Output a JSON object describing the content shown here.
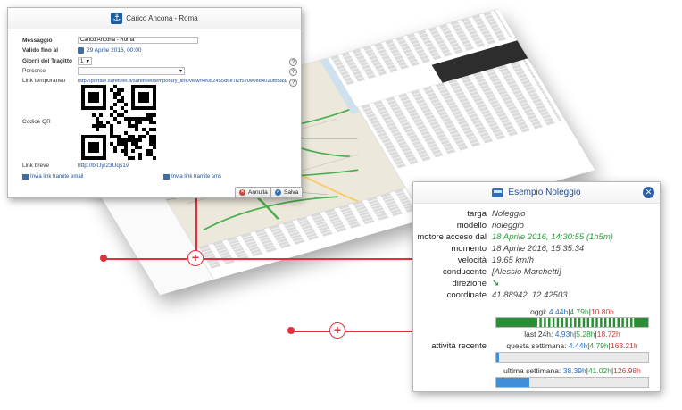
{
  "dialog": {
    "title": "Carico Ancona - Roma",
    "message_label": "Messaggio",
    "message_value": "Carico Ancona - Roma",
    "valid_label": "Valido fino al",
    "valid_value": "29 Aprile 2016, 00:00",
    "days_label": "Giorni del Tragitto",
    "days_value": "1",
    "route_label": "Percorso",
    "route_value": "------",
    "temp_link_label": "Link temporaneo",
    "temp_link_value": "http://portale.safefleet.it/safefleet/temporary_link/view/f4f082455d6e7f2f520e0eb4020fb5a9/",
    "qr_label": "Codice QR",
    "short_link_label": "Link breve",
    "short_link_value": "http://bit.ly/23Uqs1v",
    "email_link": "Invia link tramite email",
    "sms_link": "Invia link tramite sms",
    "cancel": "Annulla",
    "save": "Salva",
    "help": "?"
  },
  "popup": {
    "title": "Esempio Noleggio",
    "close": "✕",
    "rows": {
      "targa_k": "targa",
      "targa_v": "Noleggio",
      "modello_k": "modello",
      "modello_v": "noleggio",
      "motore_k": "motore acceso dal",
      "motore_v": "18 Aprile 2016, 14:30:55 (1h5m)",
      "momento_k": "momento",
      "momento_v": "18 Aprile 2016, 15:35:34",
      "velocita_k": "velocità",
      "velocita_v": "19.65 km/h",
      "conducente_k": "conducente",
      "conducente_v": "[Alessio Marchetti]",
      "direzione_k": "direzione",
      "coordinate_k": "coordinate",
      "coordinate_v": "41.88942, 12.42503"
    },
    "activity_label": "attività recente",
    "stats": {
      "today_label": "oggi:",
      "today_a": "4.44h",
      "today_b": "4.79h",
      "today_c": "10.80h",
      "last24_label": "last 24h:",
      "last24_a": "4.93h",
      "last24_b": "5.28h",
      "last24_c": "18.72h",
      "week_label": "questa settimana:",
      "week_a": "4.44h",
      "week_b": "4.79h",
      "week_c": "163.21h",
      "lastweek_label": "ultima settimana:",
      "lastweek_a": "38.39h",
      "lastweek_b": "41.02h",
      "lastweek_c": "126.98h",
      "sep": "|"
    },
    "bars": {
      "today": 1.0,
      "last24": 0.03,
      "week": 0.02,
      "lastweek": 0.22
    }
  },
  "colors": {
    "accent": "#1f4e96",
    "connector": "#e0303c",
    "traffic_green": "#4caf50"
  }
}
